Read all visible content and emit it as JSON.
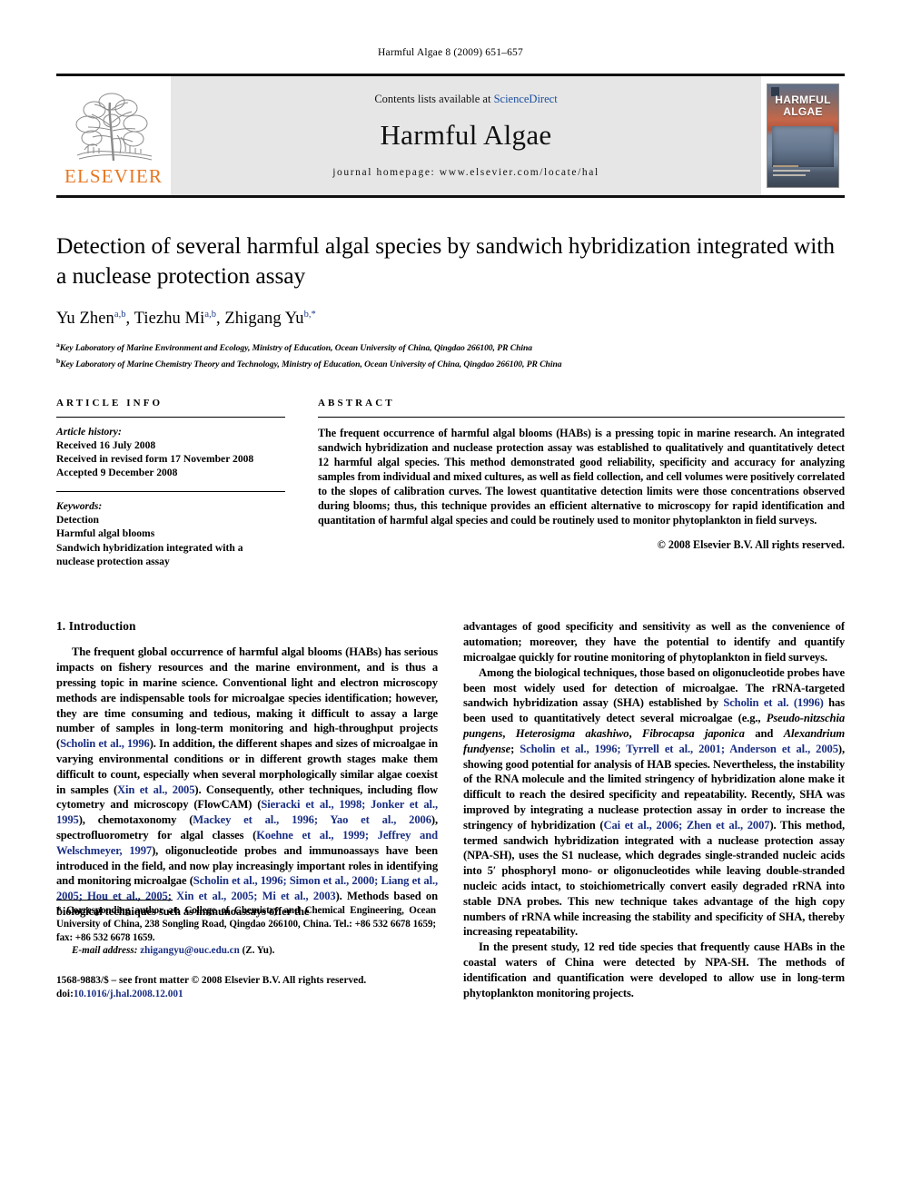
{
  "running_head": "Harmful Algae 8 (2009) 651–657",
  "masthead": {
    "publisher_name": "ELSEVIER",
    "contents_prefix": "Contents lists available at ",
    "sciencedirect": "ScienceDirect",
    "journal_title": "Harmful Algae",
    "homepage": "journal homepage: www.elsevier.com/locate/hal",
    "cover_title_line1": "HARMFUL",
    "cover_title_line2": "ALGAE",
    "accent_orange": "#E87722",
    "link_blue": "#1a4fa0",
    "cite_blue": "#1a2f83"
  },
  "title": "Detection of several harmful algal species by sandwich hybridization integrated with a nuclease protection assay",
  "authors": [
    {
      "name": "Yu Zhen",
      "sup": "a,b",
      "sep": ", "
    },
    {
      "name": "Tiezhu Mi",
      "sup": "a,b",
      "sep": ", "
    },
    {
      "name": "Zhigang Yu",
      "sup": "b,*",
      "sep": ""
    }
  ],
  "affiliations": [
    {
      "marker": "a",
      "text": "Key Laboratory of Marine Environment and Ecology, Ministry of Education, Ocean University of China, Qingdao 266100, PR China"
    },
    {
      "marker": "b",
      "text": "Key Laboratory of Marine Chemistry Theory and Technology, Ministry of Education, Ocean University of China, Qingdao 266100, PR China"
    }
  ],
  "article_info": {
    "label": "ARTICLE INFO",
    "history_head": "Article history:",
    "history": [
      "Received 16 July 2008",
      "Received in revised form 17 November 2008",
      "Accepted 9 December 2008"
    ],
    "keywords_head": "Keywords:",
    "keywords": [
      "Detection",
      "Harmful algal blooms",
      "Sandwich hybridization integrated with a",
      "nuclease protection assay"
    ]
  },
  "abstract": {
    "label": "ABSTRACT",
    "text": "The frequent occurrence of harmful algal blooms (HABs) is a pressing topic in marine research. An integrated sandwich hybridization and nuclease protection assay was established to qualitatively and quantitatively detect 12 harmful algal species. This method demonstrated good reliability, specificity and accuracy for analyzing samples from individual and mixed cultures, as well as field collection, and cell volumes were positively correlated to the slopes of calibration curves. The lowest quantitative detection limits were those concentrations observed during blooms; thus, this technique provides an efficient alternative to microscopy for rapid identification and quantitation of harmful algal species and could be routinely used to monitor phytoplankton in field surveys.",
    "copyright": "© 2008 Elsevier B.V. All rights reserved."
  },
  "section1": {
    "heading": "1. Introduction"
  },
  "footnote": {
    "corresponding": "* Corresponding author at: College of Chemistry and Chemical Engineering, Ocean University of China, 238 Songling Road, Qingdao 266100, China. Tel.: +86 532 6678 1659; fax: +86 532 6678 1659.",
    "email_label": "E-mail address:",
    "email": "zhigangyu@ouc.edu.cn",
    "email_suffix": "(Z. Yu).",
    "issn_line": "1568-9883/$ – see front matter © 2008 Elsevier B.V. All rights reserved.",
    "doi_label": "doi:",
    "doi": "10.1016/j.hal.2008.12.001"
  }
}
